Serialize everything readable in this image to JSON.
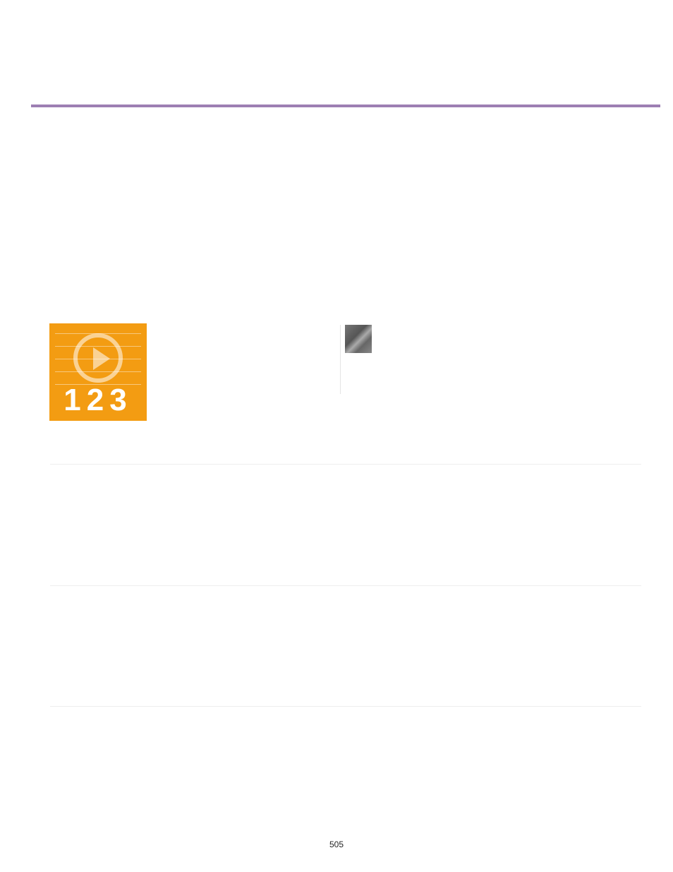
{
  "thumb": {
    "digits": "123"
  },
  "page_number": "505"
}
